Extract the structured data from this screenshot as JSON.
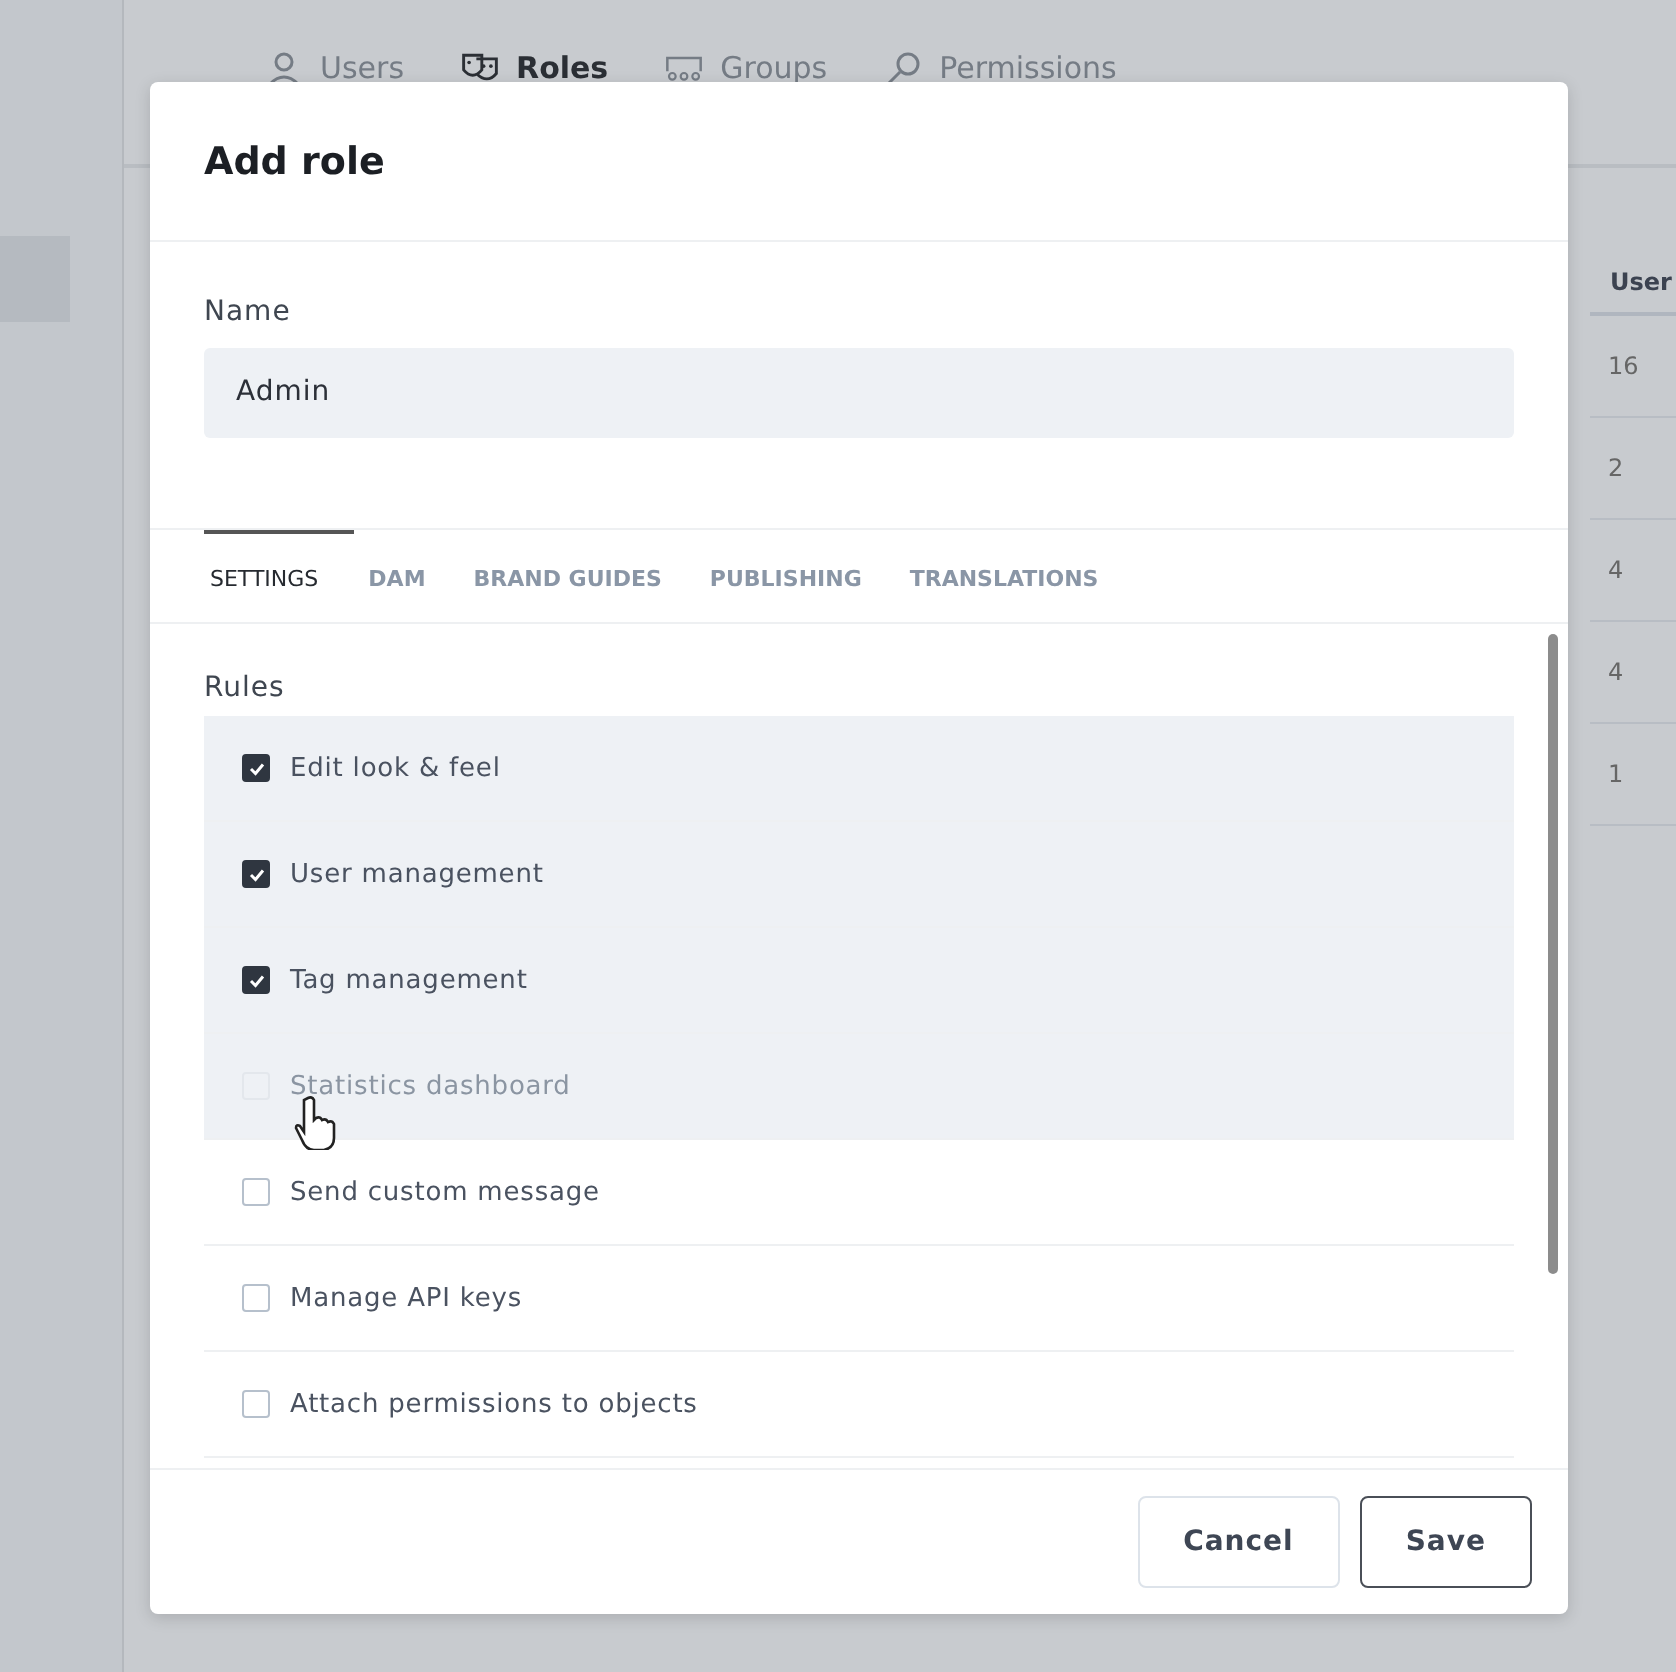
{
  "nav_tabs": [
    {
      "label": "Users",
      "selected": false
    },
    {
      "label": "Roles",
      "selected": true
    },
    {
      "label": "Groups",
      "selected": false
    },
    {
      "label": "Permissions",
      "selected": false
    }
  ],
  "table": {
    "column_1": "User",
    "rows": [
      "16",
      "2",
      "4",
      "4",
      "1"
    ]
  },
  "dialog": {
    "title": "Add role",
    "name_label": "Name",
    "name_value": "Admin",
    "tabs": [
      {
        "label": "SETTINGS",
        "selected": true
      },
      {
        "label": "DAM",
        "selected": false
      },
      {
        "label": "BRAND GUIDES",
        "selected": false
      },
      {
        "label": "PUBLISHING",
        "selected": false
      },
      {
        "label": "TRANSLATIONS",
        "selected": false
      }
    ],
    "rules_label": "Rules",
    "rules": [
      {
        "label": "Edit look & feel",
        "checked": true,
        "disabled": false,
        "hovered": false
      },
      {
        "label": "User management",
        "checked": true,
        "disabled": false,
        "hovered": false
      },
      {
        "label": "Tag management",
        "checked": true,
        "disabled": false,
        "hovered": false
      },
      {
        "label": "Statistics dashboard",
        "checked": false,
        "disabled": true,
        "hovered": true
      },
      {
        "label": "Send custom message",
        "checked": false,
        "disabled": false,
        "hovered": false
      },
      {
        "label": "Manage API keys",
        "checked": false,
        "disabled": false,
        "hovered": false
      },
      {
        "label": "Attach permissions to objects",
        "checked": false,
        "disabled": false,
        "hovered": false
      }
    ],
    "buttons": [
      "Cancel",
      "Save"
    ]
  }
}
